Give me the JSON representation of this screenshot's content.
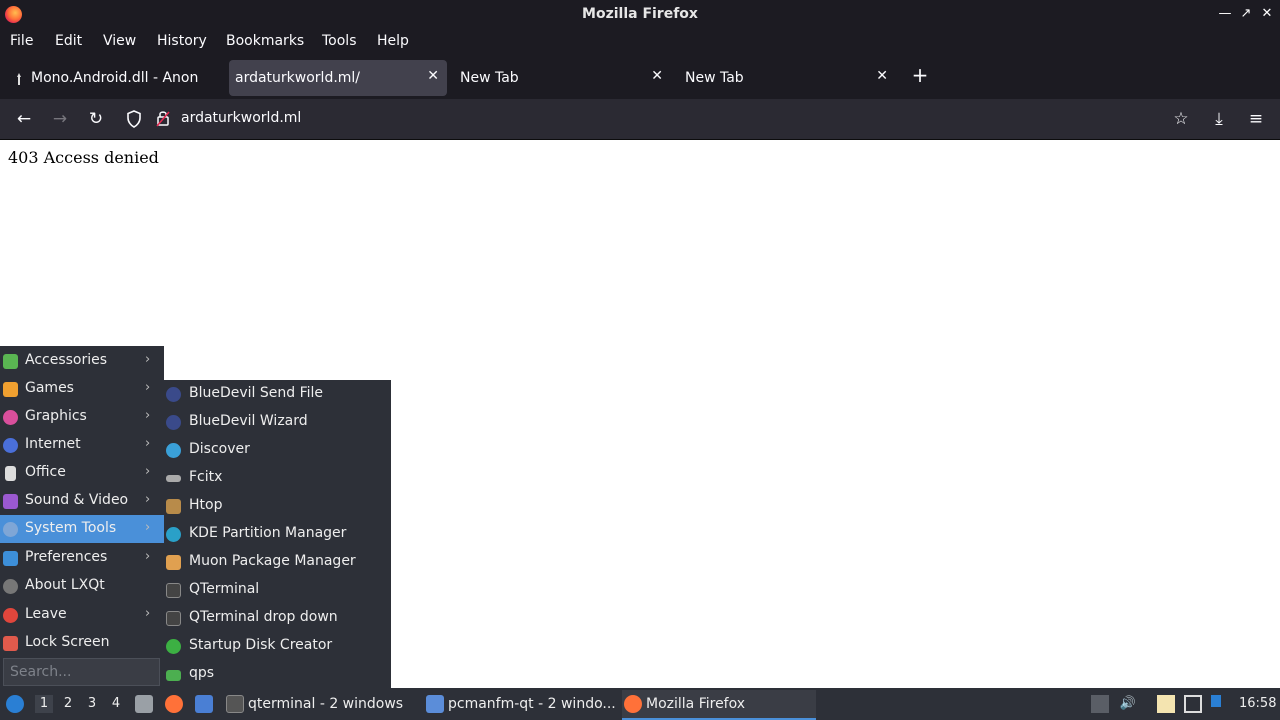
{
  "window": {
    "title": "Mozilla Firefox",
    "controls": {
      "minimize": "—",
      "maximize": "↗",
      "close": "✕"
    }
  },
  "menubar": {
    "items": [
      {
        "label": "File"
      },
      {
        "label": "Edit"
      },
      {
        "label": "View"
      },
      {
        "label": "History"
      },
      {
        "label": "Bookmarks"
      },
      {
        "label": "Tools"
      },
      {
        "label": "Help"
      }
    ]
  },
  "tabs": [
    {
      "label": "Mono.Android.dll - AnonF",
      "active": false
    },
    {
      "label": "ardaturkworld.ml/",
      "active": true
    },
    {
      "label": "New Tab",
      "active": false
    },
    {
      "label": "New Tab",
      "active": false
    }
  ],
  "tab_close_glyph": "✕",
  "new_tab_glyph": "+",
  "navbar": {
    "back": "←",
    "forward": "→",
    "reload": "↻",
    "url": "ardaturkworld.ml",
    "bookmark": "☆",
    "download": "⤓",
    "menu": "≡"
  },
  "page": {
    "message": "403 Access denied"
  },
  "start_menu": {
    "items": [
      {
        "label": "Accessories",
        "icon": "accessories-icon",
        "color": "#5ab552",
        "submenu": true
      },
      {
        "label": "Games",
        "icon": "games-icon",
        "color": "#f0a030",
        "submenu": true
      },
      {
        "label": "Graphics",
        "icon": "graphics-icon",
        "color": "#d94f9c",
        "submenu": true
      },
      {
        "label": "Internet",
        "icon": "internet-icon",
        "color": "#4a6fd9",
        "submenu": true
      },
      {
        "label": "Office",
        "icon": "office-icon",
        "color": "#dddddd",
        "submenu": true
      },
      {
        "label": "Sound & Video",
        "icon": "sound-video-icon",
        "color": "#9b59d0",
        "submenu": true
      },
      {
        "label": "System Tools",
        "icon": "system-tools-icon",
        "color": "#7fa6d6",
        "submenu": true,
        "highlighted": true
      },
      {
        "label": "Preferences",
        "icon": "preferences-icon",
        "color": "#3d8fd9",
        "submenu": true
      },
      {
        "label": "About LXQt",
        "icon": "about-icon",
        "color": "#777777",
        "submenu": false
      },
      {
        "label": "Leave",
        "icon": "leave-icon",
        "color": "#e0463c",
        "submenu": true
      },
      {
        "label": "Lock Screen",
        "icon": "lock-icon",
        "color": "#e05a4c",
        "submenu": false
      }
    ],
    "arrow_glyph": "›",
    "search_placeholder": "Search..."
  },
  "submenu": {
    "items": [
      {
        "label": "BlueDevil Send File",
        "icon": "bluetooth-icon",
        "color": "#3a4a8a"
      },
      {
        "label": "BlueDevil Wizard",
        "icon": "bluetooth-icon",
        "color": "#3a4a8a"
      },
      {
        "label": "Discover",
        "icon": "discover-icon",
        "color": "#3aa0d8"
      },
      {
        "label": "Fcitx",
        "icon": "keyboard-icon",
        "color": "#aaaaaa"
      },
      {
        "label": "Htop",
        "icon": "htop-icon",
        "color": "#b88b4a"
      },
      {
        "label": "KDE Partition Manager",
        "icon": "partition-icon",
        "color": "#2aa0c8"
      },
      {
        "label": "Muon Package Manager",
        "icon": "package-icon",
        "color": "#e0a050"
      },
      {
        "label": "QTerminal",
        "icon": "terminal-icon",
        "color": "#444444"
      },
      {
        "label": "QTerminal drop down",
        "icon": "terminal-icon",
        "color": "#444444"
      },
      {
        "label": "Startup Disk Creator",
        "icon": "usb-disk-icon",
        "color": "#3cb043"
      },
      {
        "label": "qps",
        "icon": "folder-icon",
        "color": "#4caf50"
      }
    ]
  },
  "taskbar": {
    "desktops": [
      "1",
      "2",
      "3",
      "4"
    ],
    "tasks": [
      {
        "label": "qterminal - 2 windows",
        "icon": "terminal-icon",
        "color": "#555555",
        "active": false
      },
      {
        "label": "pcmanfm-qt - 2 windo...",
        "icon": "folder-icon",
        "color": "#5b8dd9",
        "active": false
      },
      {
        "label": "Mozilla Firefox",
        "icon": "firefox-icon",
        "color": "#ff7139",
        "active": true
      }
    ],
    "clock": "16:58"
  }
}
